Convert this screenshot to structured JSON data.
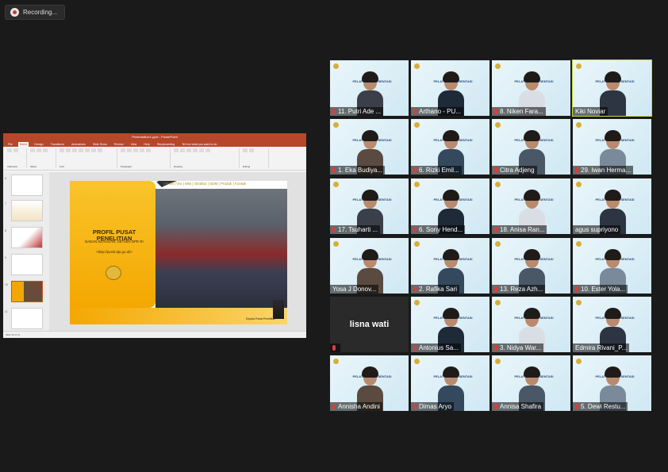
{
  "recording": {
    "label": "Recording..."
  },
  "shared_screen": {
    "window_title": "Presentation1.pptx - PowerPoint",
    "tabs": [
      "File",
      "Home",
      "Design",
      "Transitions",
      "Animations",
      "Slide Show",
      "Review",
      "View",
      "Help",
      "Storyboarding",
      "Tell me what you want to do"
    ],
    "active_tab": "Home",
    "ribbon_groups": [
      "Clipboard",
      "Slides",
      "Font",
      "Paragraph",
      "Drawing",
      "Editing"
    ],
    "slide_numbers": [
      "6",
      "7",
      "8",
      "9",
      "10",
      "11"
    ],
    "slide": {
      "nav": "| Profil | Visi | Misi | Struktur | SDM | Produk | Kontak",
      "title": "PROFIL PUSAT PENELITIAN",
      "subtitle": "BADAN KEAHLIAN, SETJEN DPR RI",
      "url": "<http://puslit.dpr.go.id/>",
      "speaker_label": "Kepala Pusat Penelitian"
    },
    "status_bar": "Slide 10 of 11"
  },
  "participants": [
    {
      "name": "11. Putri Ade ...",
      "muted": true
    },
    {
      "name": "Arthano - PU...",
      "muted": true
    },
    {
      "name": "8. Niken Fara...",
      "muted": true
    },
    {
      "name": "Kiki Noviar",
      "muted": false,
      "active": true
    },
    {
      "name": "1. Eka Budiya...",
      "muted": true
    },
    {
      "name": "6. Rizki Emil...",
      "muted": true
    },
    {
      "name": "Citra Adjeng",
      "muted": true
    },
    {
      "name": "29. Iwan Herma...",
      "muted": true
    },
    {
      "name": "17. Tsuharti ...",
      "muted": true
    },
    {
      "name": "6. Sony Hend...",
      "muted": true
    },
    {
      "name": "18. Anisa Ran...",
      "muted": true
    },
    {
      "name": "agus supriyono",
      "muted": false
    },
    {
      "name": "Yosa J Donov...",
      "muted": false
    },
    {
      "name": "2. Rafika Sari",
      "muted": true
    },
    {
      "name": "13. Reza Azh...",
      "muted": true
    },
    {
      "name": "10. Ester Yola...",
      "muted": true
    },
    {
      "name": "lisna wati",
      "muted": true,
      "video_off": true
    },
    {
      "name": "Antonius Sa...",
      "muted": true
    },
    {
      "name": "3. Nidya War...",
      "muted": true
    },
    {
      "name": "Edmira Rivani_P...",
      "muted": false
    },
    {
      "name": "Annisha Andini",
      "muted": true
    },
    {
      "name": "Dimas Aryo",
      "muted": true
    },
    {
      "name": "Annisa Shafira",
      "muted": true
    },
    {
      "name": "5. Dewi Restu...",
      "muted": true
    }
  ],
  "presentation_bg_title": "PELATIHAN PRESENTASI",
  "colors": {
    "mute_red": "#e53935",
    "active_speaker": "#c8d93a",
    "powerpoint": "#b7472a"
  }
}
